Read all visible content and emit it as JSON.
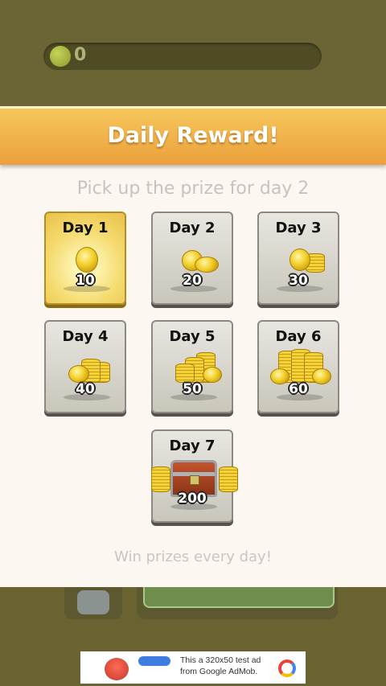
{
  "hud": {
    "coin_count": "0"
  },
  "dialog": {
    "title": "Daily Reward!",
    "subtitle": "Pick up the prize for day 2",
    "footer": "Win prizes every day!",
    "days": [
      {
        "label": "Day  1",
        "amount": "10"
      },
      {
        "label": "Day 2",
        "amount": "20"
      },
      {
        "label": "Day 3",
        "amount": "30"
      },
      {
        "label": "Day 4",
        "amount": "40"
      },
      {
        "label": "Day 5",
        "amount": "50"
      },
      {
        "label": "Day 6",
        "amount": "60"
      },
      {
        "label": "Day 7",
        "amount": "200"
      }
    ]
  },
  "ad": {
    "text": "This a 320x50 test ad from Google AdMob."
  },
  "colors": {
    "header": "#eba03c",
    "active_card": "#f5db6f",
    "card": "#d9d6cc",
    "background": "#6a6331"
  }
}
